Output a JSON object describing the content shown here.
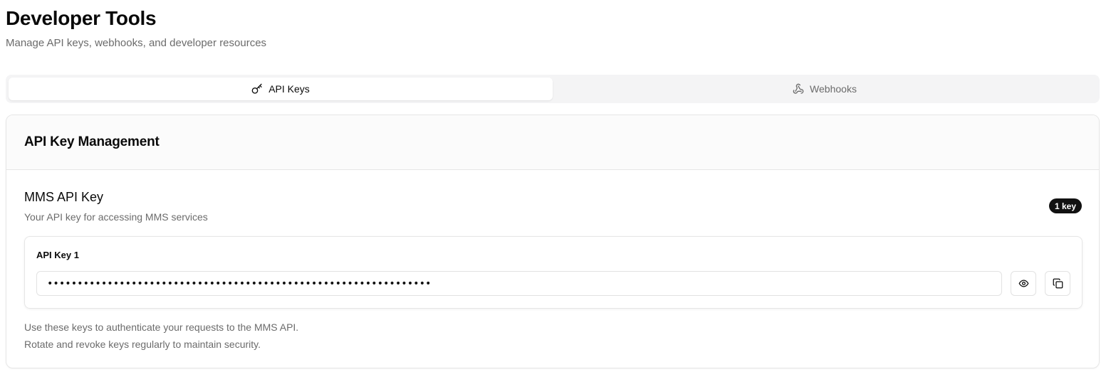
{
  "header": {
    "title": "Developer Tools",
    "subtitle": "Manage API keys, webhooks, and developer resources"
  },
  "tabs": [
    {
      "label": "API Keys",
      "icon": "key-icon",
      "active": true
    },
    {
      "label": "Webhooks",
      "icon": "webhook-icon",
      "active": false
    }
  ],
  "card": {
    "title": "API Key Management",
    "section_title": "MMS API Key",
    "section_description": "Your API key for accessing MMS services",
    "badge": "1 key",
    "keys": [
      {
        "label": "API Key 1",
        "masked_value": "••••••••••••••••••••••••••••••••••••••••••••••••••••••••••••••••"
      }
    ],
    "notes": [
      "Use these keys to authenticate your requests to the MMS API.",
      "Rotate and revoke keys regularly to maintain security."
    ]
  },
  "colors": {
    "accent": "#111111",
    "muted_text": "#6b6b6b",
    "tab_bg": "#f4f4f5",
    "border": "#e6e6e6"
  }
}
